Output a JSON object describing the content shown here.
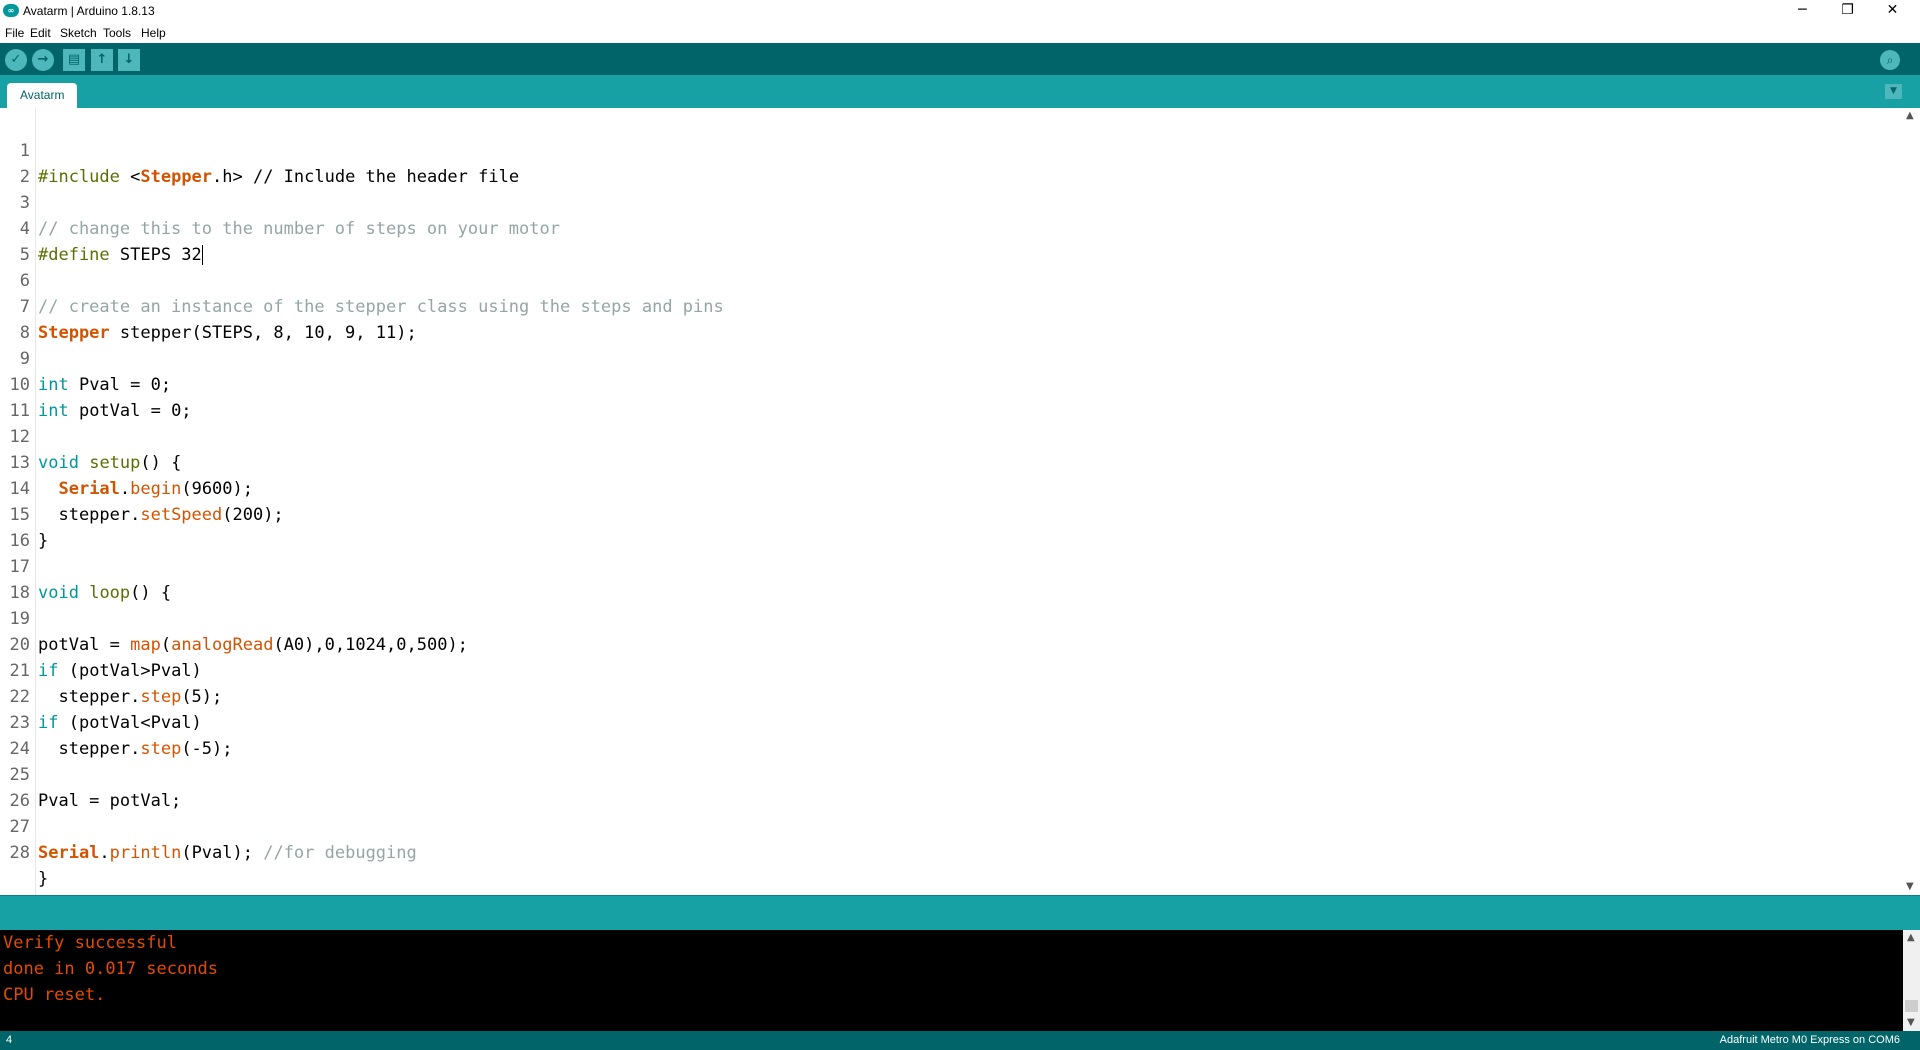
{
  "window": {
    "title": "Avatarm | Arduino 1.8.13",
    "app_icon_text": "∞",
    "minimize": "─",
    "restore": "❐",
    "close": "✕"
  },
  "menu": [
    "File",
    "Edit",
    "Sketch",
    "Tools",
    "Help"
  ],
  "toolbar": {
    "verify_icon": "✓",
    "upload_icon": "→",
    "new_icon": "▤",
    "open_icon": "↑",
    "save_icon": "↓",
    "serial_monitor_icon": "⌕"
  },
  "tabs": [
    {
      "label": "Avatarm",
      "active": true
    }
  ],
  "tab_menu_icon": "▼",
  "code_lines": [
    "1",
    "2",
    "3",
    "4",
    "5",
    "6",
    "7",
    "8",
    "9",
    "10",
    "11",
    "12",
    "13",
    "14",
    "15",
    "16",
    "17",
    "18",
    "19",
    "20",
    "21",
    "22",
    "23",
    "24",
    "25",
    "26",
    "27",
    "28"
  ],
  "code": {
    "l1": {
      "a": "#include",
      "b": " <",
      "c": "Stepper",
      "d": ".h> // Include the header file"
    },
    "l3": "// change this to the number of steps on your motor",
    "l4": {
      "a": "#define",
      "b": " STEPS 32"
    },
    "l6": "// create an instance of the stepper class using the steps and pins",
    "l7": {
      "a": "Stepper",
      "b": " stepper(STEPS, 8, 10, 9, 11);"
    },
    "l9": {
      "a": "int",
      "b": " Pval = 0;"
    },
    "l10": {
      "a": "int",
      "b": " potVal = 0;"
    },
    "l12": {
      "a": "void",
      "b": " ",
      "c": "setup",
      "d": "() {"
    },
    "l13": {
      "a": "  ",
      "b": "Serial",
      "c": ".",
      "d": "begin",
      "e": "(9600);"
    },
    "l14": {
      "a": "  stepper.",
      "b": "setSpeed",
      "c": "(200);"
    },
    "l15": "}",
    "l17": {
      "a": "void",
      "b": " ",
      "c": "loop",
      "d": "() {"
    },
    "l19": {
      "a": "potVal = ",
      "b": "map",
      "c": "(",
      "d": "analogRead",
      "e": "(A0),0,1024,0,500);"
    },
    "l20": {
      "a": "if",
      "b": " (potVal>Pval)"
    },
    "l21": {
      "a": "  stepper.",
      "b": "step",
      "c": "(5);"
    },
    "l22": {
      "a": "if",
      "b": " (potVal<Pval)"
    },
    "l23": {
      "a": "  stepper.",
      "b": "step",
      "c": "(-5);"
    },
    "l25": "Pval = potVal;",
    "l27": {
      "a": "Serial",
      "b": ".",
      "c": "println",
      "d": "(Pval); ",
      "e": "//for debugging"
    },
    "l28": "}"
  },
  "console": [
    "Verify successful",
    "done in 0.017 seconds",
    "CPU reset."
  ],
  "status": {
    "line": "4",
    "board": "Adafruit Metro M0 Express on COM6"
  },
  "colors": {
    "toolbar": "#006468",
    "tabbar": "#17a1a5",
    "keyword": "#00979c",
    "function": "#d35400",
    "comment": "#95a5a6",
    "console_text": "#e34c00"
  }
}
